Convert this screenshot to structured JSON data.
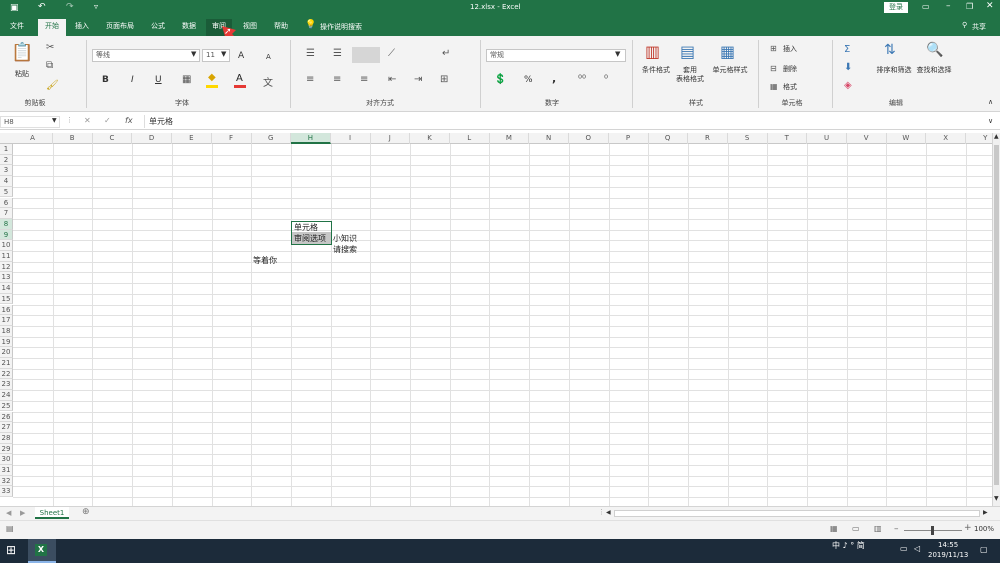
{
  "window": {
    "title": "12.xlsx - Excel",
    "login_label": "登录",
    "share_label": "共享"
  },
  "tabs": [
    {
      "label": "文件"
    },
    {
      "label": "开始"
    },
    {
      "label": "插入"
    },
    {
      "label": "页面布局"
    },
    {
      "label": "公式"
    },
    {
      "label": "数据"
    },
    {
      "label": "审阅"
    },
    {
      "label": "视图"
    },
    {
      "label": "帮助"
    }
  ],
  "tell_me": "操作说明搜索",
  "ribbon": {
    "clipboard": {
      "paste_label": "粘贴",
      "group_label": "剪贴板"
    },
    "font": {
      "font_name": "等线",
      "font_size": "11",
      "group_label": "字体",
      "bold": "B",
      "italic": "I",
      "underline": "U",
      "increase": "A",
      "decrease": "A",
      "font_color_glyph": "A"
    },
    "alignment": {
      "group_label": "对齐方式"
    },
    "number": {
      "format": "常规",
      "percent": "%",
      "comma": ",",
      "group_label": "数字"
    },
    "styles": {
      "conditional": "条件格式",
      "table_format_line1": "套用",
      "table_format_line2": "表格格式",
      "cell_styles": "单元格样式",
      "group_label": "样式"
    },
    "cells": {
      "insert": "插入",
      "delete": "删除",
      "format": "格式",
      "group_label": "单元格"
    },
    "editing": {
      "sort_filter": "排序和筛选",
      "find_select": "查找和选择",
      "group_label": "编辑"
    }
  },
  "formula_bar": {
    "name_box": "H8",
    "fx": "fx",
    "content": "单元格"
  },
  "columns": [
    "A",
    "B",
    "C",
    "D",
    "E",
    "F",
    "G",
    "H",
    "I",
    "J",
    "K",
    "L",
    "M",
    "N",
    "O",
    "P",
    "Q",
    "R",
    "S",
    "T",
    "U",
    "V",
    "W",
    "X",
    "Y"
  ],
  "rows": [
    "1",
    "2",
    "3",
    "4",
    "5",
    "6",
    "7",
    "8",
    "9",
    "10",
    "11",
    "12",
    "13",
    "14",
    "15",
    "16",
    "17",
    "18",
    "19",
    "20",
    "21",
    "22",
    "23",
    "24",
    "25",
    "26",
    "27",
    "28",
    "29",
    "30",
    "31",
    "32",
    "33"
  ],
  "cells": {
    "h8": "单元格",
    "h9": "审阅选项",
    "i9": "小知识",
    "i10": "请搜索",
    "g11": "等着你"
  },
  "sheet_tab": "Sheet1",
  "status": {
    "zoom": "100%"
  },
  "taskbar": {
    "ime": "中 ♪ ° 简",
    "time": "14:55",
    "date": "2019/11/13",
    "app_badge": "X"
  },
  "colors": {
    "excel_green": "#217346",
    "arrow_red": "#e53935"
  }
}
